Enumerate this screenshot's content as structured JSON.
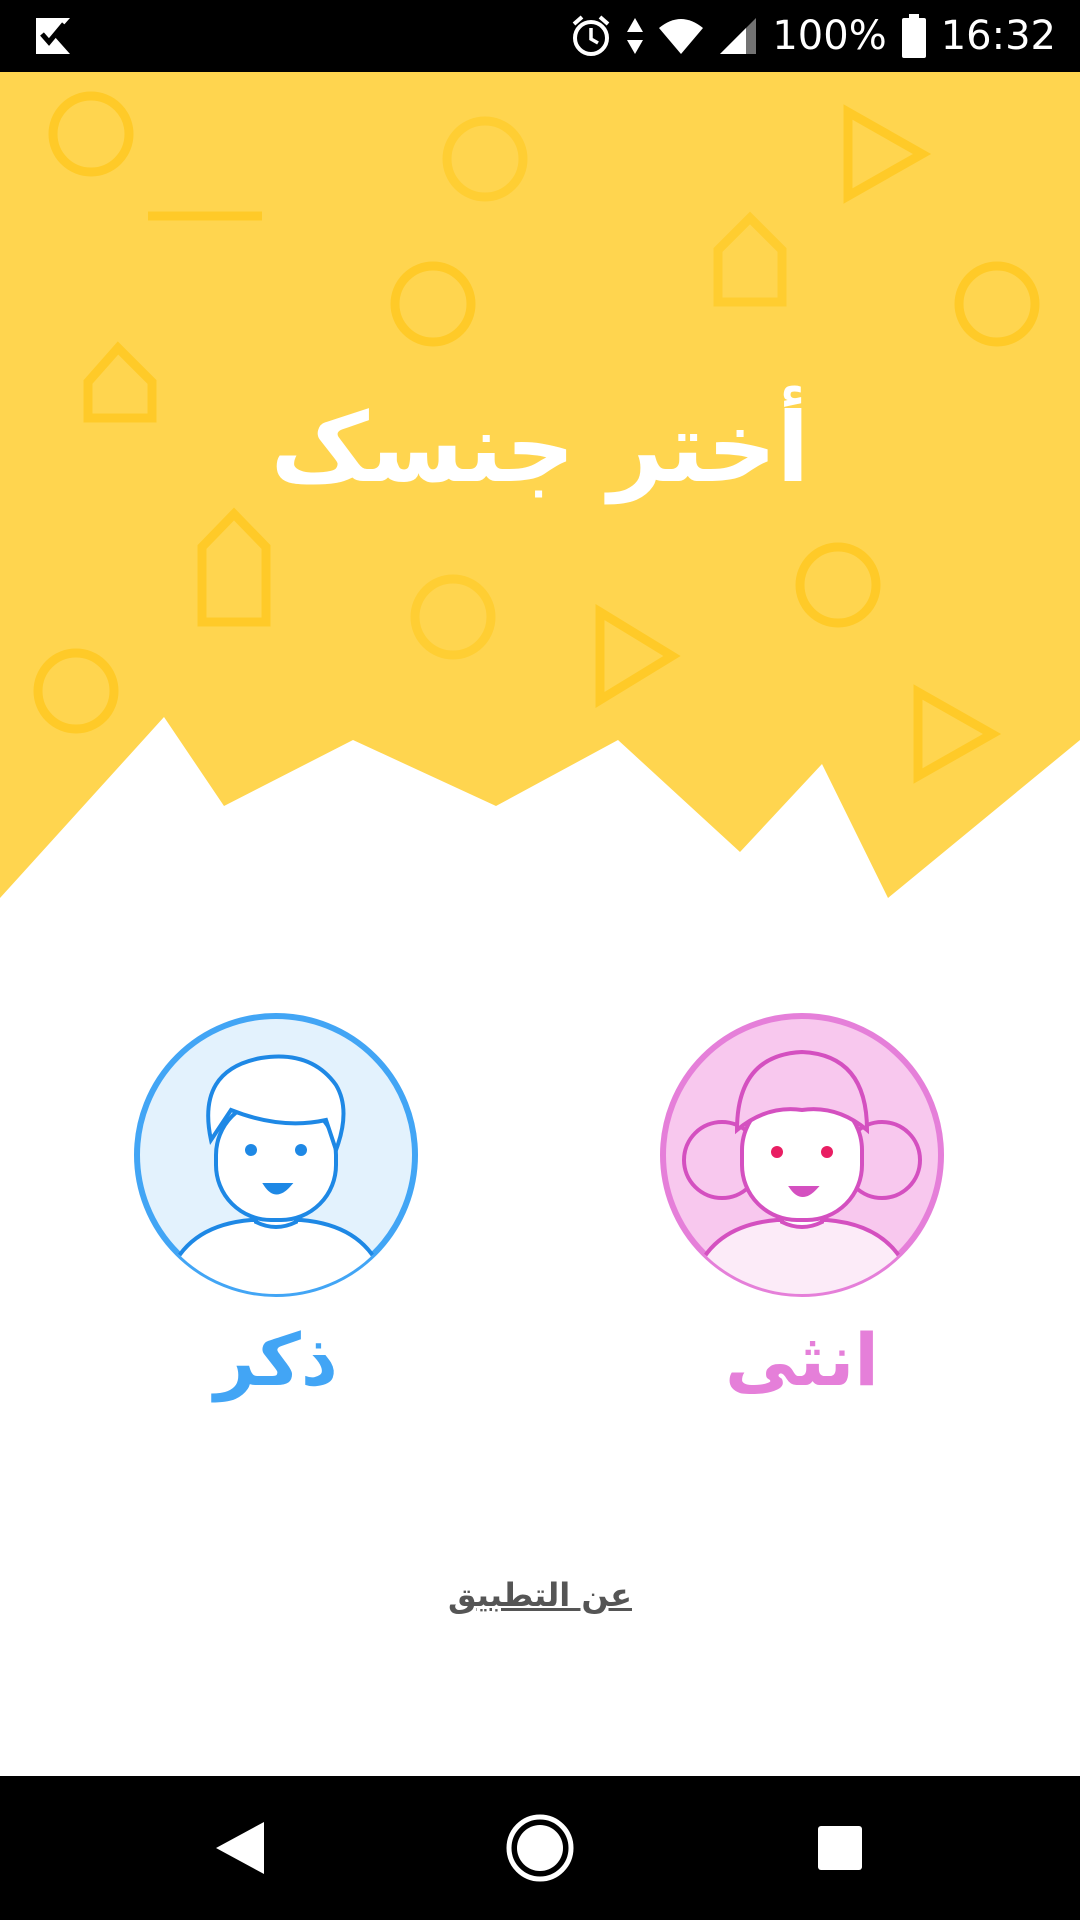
{
  "status_bar": {
    "battery_percent": "100%",
    "time": "16:32",
    "icons": [
      "app-check-icon",
      "alarm-icon",
      "data-arrows-icon",
      "wifi-icon",
      "signal-icon",
      "battery-icon"
    ]
  },
  "header": {
    "title": "أختر جنسک",
    "background_color": "#FFD54F",
    "pattern_color": "#FFCA28"
  },
  "options": {
    "male": {
      "label": "ذكر",
      "color": "#42A5F5",
      "avatar": "boy-avatar-icon"
    },
    "female": {
      "label": "انثى",
      "color": "#E57FD9",
      "avatar": "girl-avatar-icon"
    }
  },
  "footer": {
    "about_label": "عن التطبيق"
  },
  "nav_bar": {
    "icons": [
      "back-icon",
      "home-icon",
      "recents-icon"
    ]
  }
}
